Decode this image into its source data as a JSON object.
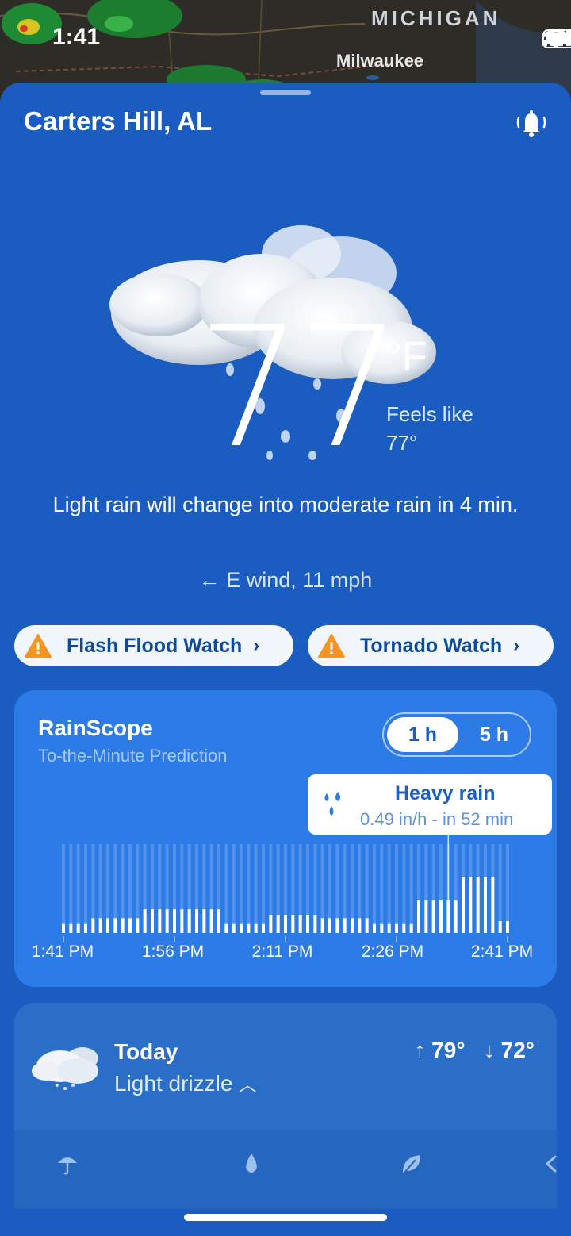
{
  "status_bar": {
    "time": "1:41"
  },
  "map": {
    "state_label": "MICHIGAN",
    "city_label": "Milwaukee"
  },
  "header": {
    "location": "Carters Hill, AL"
  },
  "current": {
    "temperature": "77",
    "unit": "°F",
    "feels_like_label": "Feels like",
    "feels_like_value": "77°",
    "summary": "Light rain will change into moderate rain in 4 min.",
    "wind": "← E wind, 11 mph"
  },
  "alerts": [
    {
      "label": "Flash Flood Watch",
      "icon": "warning-icon"
    },
    {
      "label": "Tornado Watch",
      "icon": "warning-icon"
    }
  ],
  "rainscope": {
    "title": "RainScope",
    "subtitle": "To-the-Minute Prediction",
    "segments": [
      "1 h",
      "5 h"
    ],
    "selected_segment": "1 h",
    "tooltip_title": "Heavy rain",
    "tooltip_detail": "0.49 in/h - in 52 min",
    "time_labels": [
      "1:41 PM",
      "1:56 PM",
      "2:11 PM",
      "2:26 PM",
      "2:41 PM"
    ]
  },
  "chart_data": {
    "type": "bar",
    "title": "RainScope",
    "xlabel": "",
    "ylabel": "",
    "x_tick_labels": [
      "1:41 PM",
      "1:56 PM",
      "2:11 PM",
      "2:26 PM",
      "2:41 PM"
    ],
    "minutes_from_now": [
      0,
      1,
      2,
      3,
      4,
      5,
      6,
      7,
      8,
      9,
      10,
      11,
      12,
      13,
      14,
      15,
      16,
      17,
      18,
      19,
      20,
      21,
      22,
      23,
      24,
      25,
      26,
      27,
      28,
      29,
      30,
      31,
      32,
      33,
      34,
      35,
      36,
      37,
      38,
      39,
      40,
      41,
      42,
      43,
      44,
      45,
      46,
      47,
      48,
      49,
      50,
      51,
      52,
      53,
      54,
      55,
      56,
      57,
      58,
      59,
      60
    ],
    "intensity": [
      0.03,
      0.03,
      0.03,
      0.03,
      0.05,
      0.05,
      0.05,
      0.05,
      0.05,
      0.05,
      0.05,
      0.08,
      0.08,
      0.08,
      0.08,
      0.08,
      0.08,
      0.08,
      0.08,
      0.08,
      0.08,
      0.08,
      0.03,
      0.03,
      0.03,
      0.03,
      0.03,
      0.03,
      0.06,
      0.06,
      0.06,
      0.06,
      0.06,
      0.06,
      0.06,
      0.05,
      0.05,
      0.05,
      0.05,
      0.05,
      0.05,
      0.05,
      0.03,
      0.03,
      0.03,
      0.03,
      0.03,
      0.03,
      0.11,
      0.11,
      0.11,
      0.11,
      0.11,
      0.11,
      0.19,
      0.19,
      0.19,
      0.19,
      0.19,
      0.04,
      0.04
    ],
    "ylim": [
      0,
      0.3
    ],
    "highlight": {
      "minutes_from_now": 52,
      "label": "Heavy rain",
      "value": "0.49 in/h"
    }
  },
  "forecast_today": {
    "day": "Today",
    "description": "Light drizzle",
    "high": "↑ 79°",
    "low": "↓ 72°"
  },
  "tabs": [
    "umbrella-icon",
    "drop-icon",
    "leaf-icon",
    "chevron-left-icon"
  ]
}
